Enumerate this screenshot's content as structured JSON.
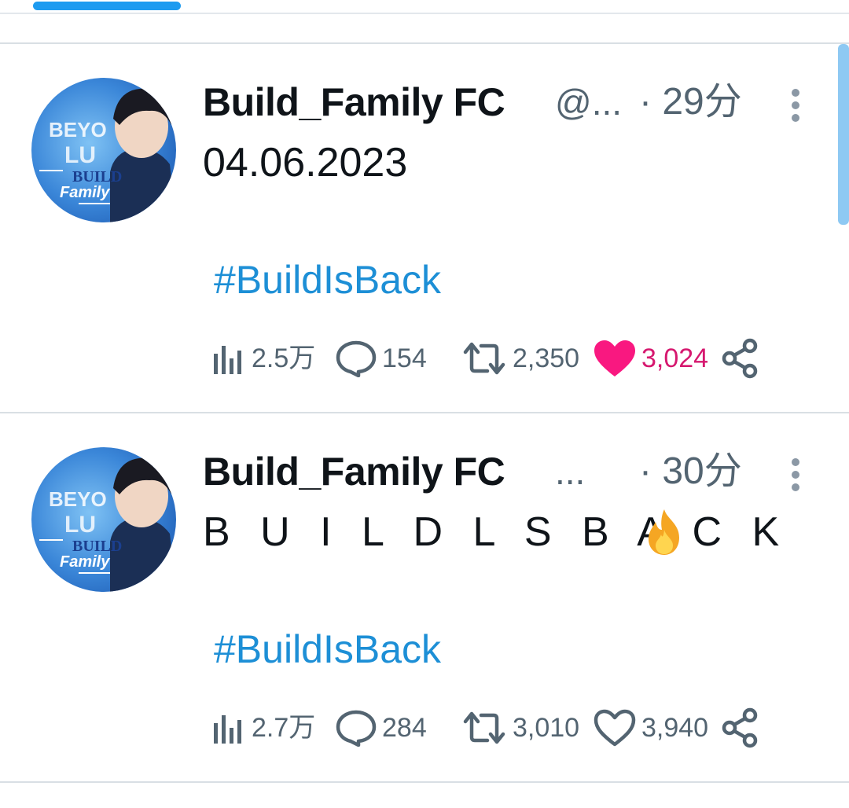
{
  "posts": [
    {
      "author": {
        "display_name": "Build_Family FC",
        "handle": "@...",
        "avatar_icon": "avatar-image"
      },
      "timestamp": "· 29分",
      "body": "04.06.2023",
      "hashtag": "#BuildIsBack",
      "stats": {
        "views": "2.5万",
        "replies": "154",
        "reposts": "2,350",
        "likes": "3,024",
        "liked": true
      }
    },
    {
      "author": {
        "display_name": "Build_Family FC",
        "handle": "...",
        "avatar_icon": "avatar-image"
      },
      "timestamp": "· 30分",
      "body": "B U I L D L S B A C K",
      "body_emoji": "fire-icon",
      "hashtag": "#BuildIsBack",
      "stats": {
        "views": "2.7万",
        "replies": "284",
        "reposts": "3,010",
        "likes": "3,940",
        "liked": false
      }
    }
  ],
  "colors": {
    "accent": "#1d9bf0",
    "hashtag": "#1d8fd6",
    "like_active": "#f91880",
    "like_count_active": "#d6186f",
    "secondary_text": "#536471"
  }
}
